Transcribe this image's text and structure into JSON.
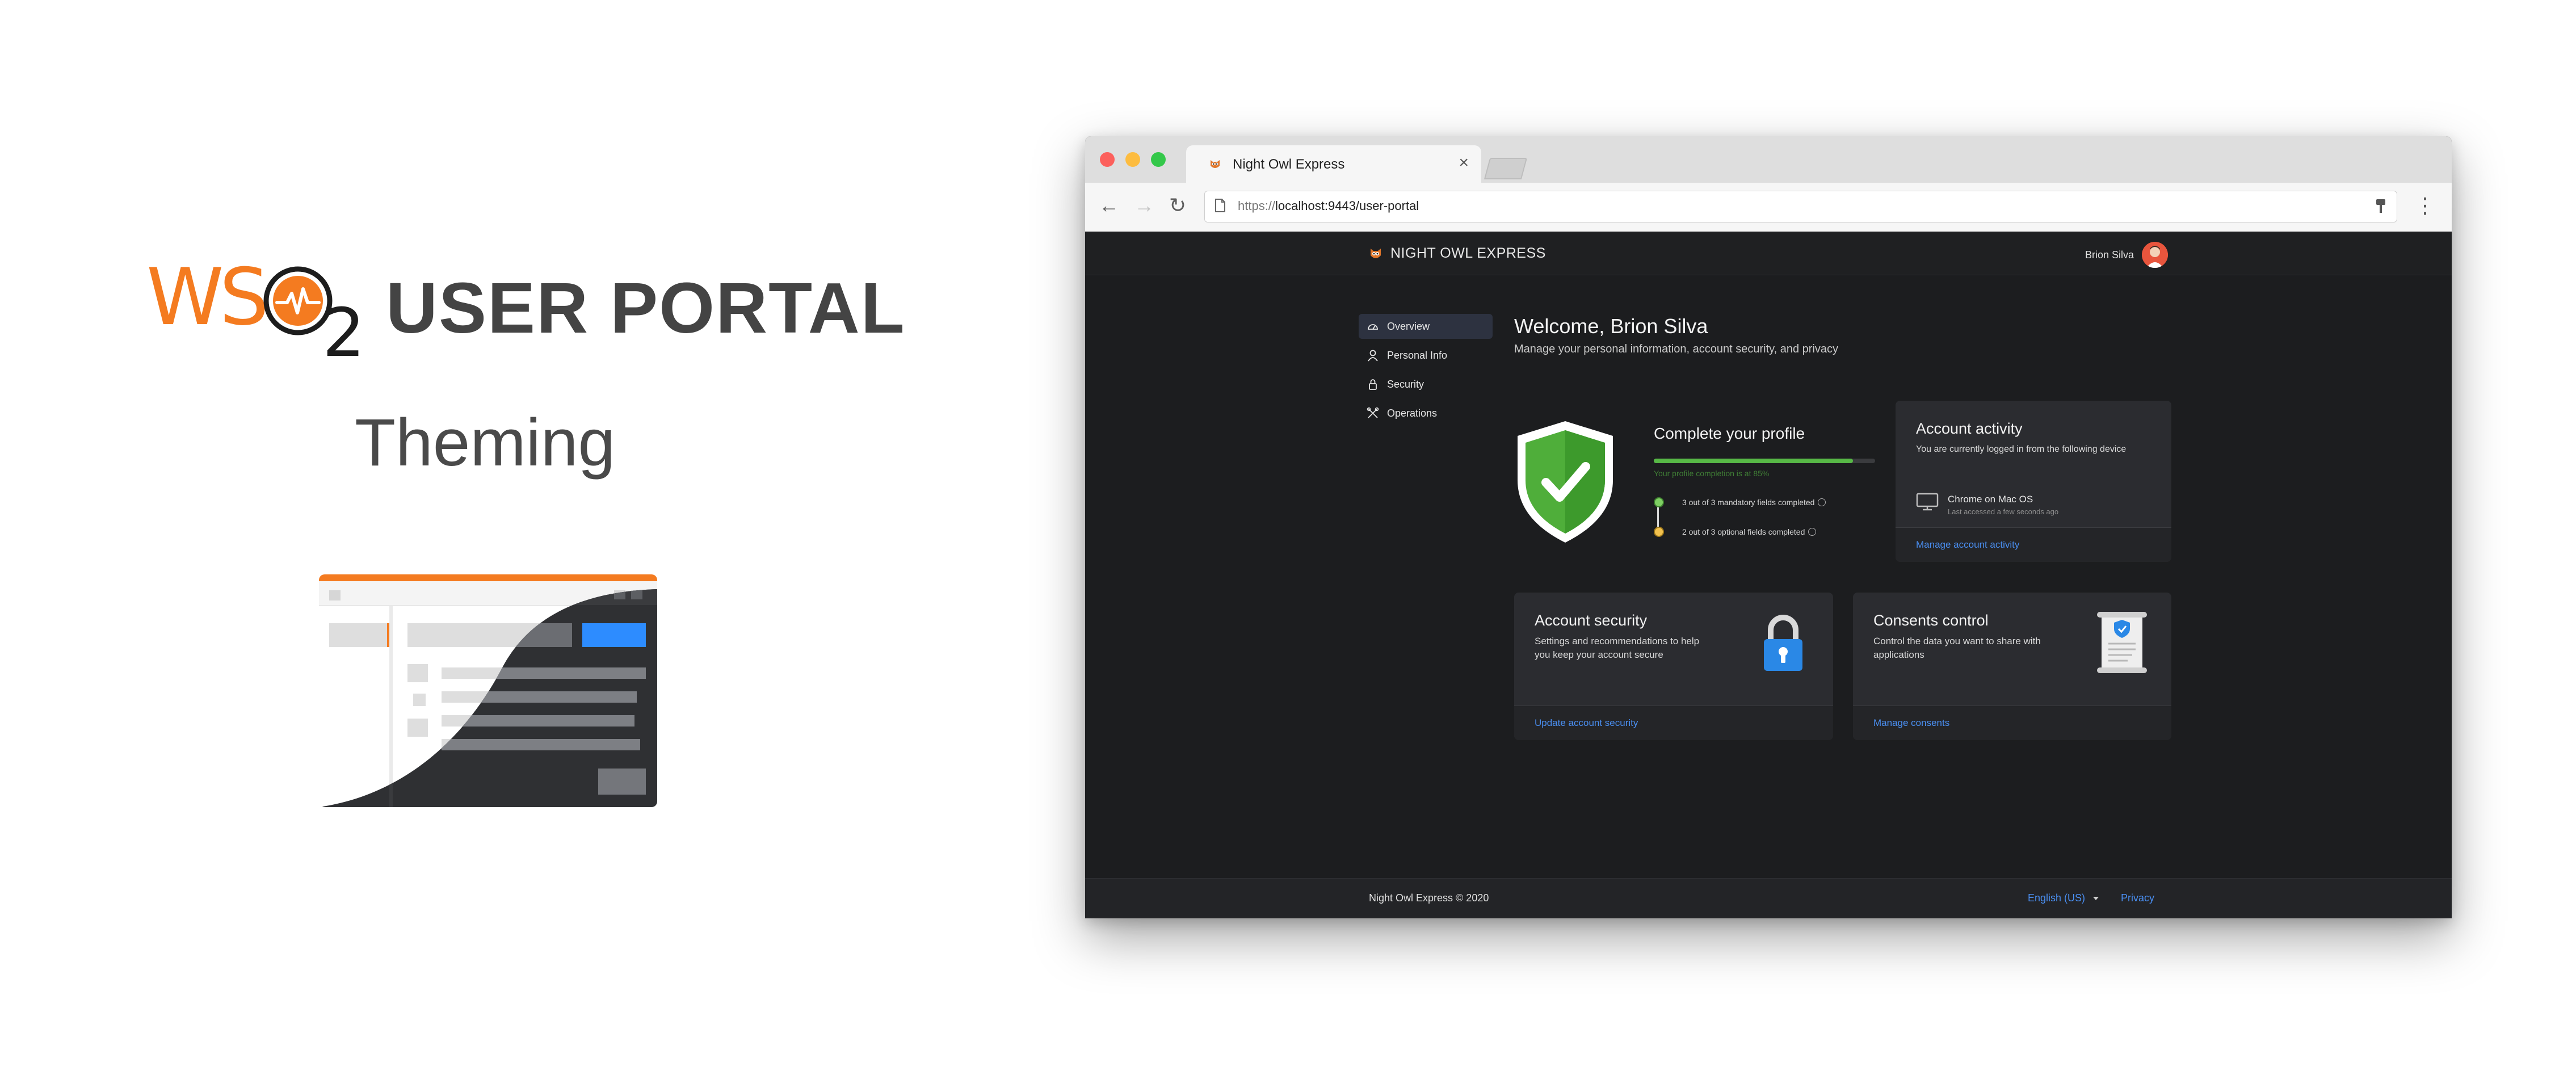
{
  "promo": {
    "logo_letters": "WS",
    "logo_o": "O",
    "logo_sub": "2",
    "portal_title": "USER PORTAL",
    "subtitle": "Theming",
    "accent_color": "#f47b20"
  },
  "browser": {
    "tab_title": "Night Owl Express",
    "tab_close": "×",
    "url_scheme": "https://",
    "url_rest": "localhost:9443/user-portal",
    "back_icon": "←",
    "forward_icon": "→",
    "reload_icon": "↻",
    "menu_icon": "⋮"
  },
  "app": {
    "brand_name": "NIGHT OWL EXPRESS",
    "user_name": "Brion Silva",
    "sidebar": [
      {
        "label": "Overview",
        "icon": "dashboard-icon",
        "active": true
      },
      {
        "label": "Personal Info",
        "icon": "user-icon",
        "active": false
      },
      {
        "label": "Security",
        "icon": "lock-icon",
        "active": false
      },
      {
        "label": "Operations",
        "icon": "tools-icon",
        "active": false
      }
    ],
    "welcome_title": "Welcome, Brion Silva",
    "welcome_sub": "Manage your personal information, account security, and privacy",
    "profile": {
      "title": "Complete your profile",
      "progress_text": "Your profile completion is at 85%",
      "progress": 0.9,
      "step1": "3 out of 3 mandatory fields completed",
      "step2": "2 out of 3 optional fields completed"
    },
    "activity": {
      "title": "Account activity",
      "desc": "You are currently logged in from the following device",
      "device": "Chrome on Mac OS",
      "device_time": "Last accessed a few seconds ago",
      "link": "Manage account activity"
    },
    "security": {
      "title": "Account security",
      "desc": "Settings and recommendations to help you keep your account secure",
      "link": "Update account security"
    },
    "consents": {
      "title": "Consents control",
      "desc": "Control the data you want to share with applications",
      "link": "Manage consents"
    },
    "footer": {
      "copyright": "Night Owl Express © 2020",
      "language": "English (US)",
      "privacy": "Privacy"
    },
    "colors": {
      "background": "#1c1d1f",
      "card": "#2b2c30",
      "link": "#4a8ff2",
      "success": "#57b846"
    }
  }
}
